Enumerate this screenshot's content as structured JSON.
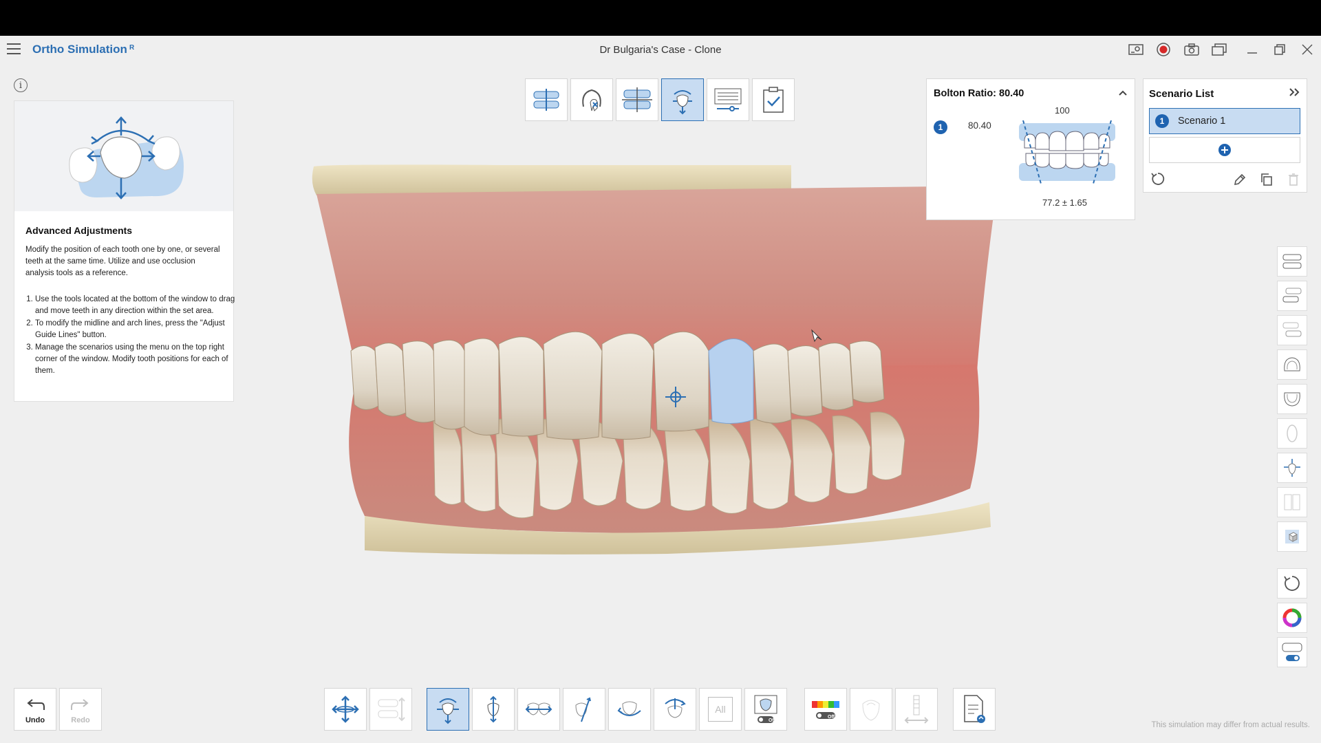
{
  "app": {
    "title": "Ortho Simulation",
    "title_suffix": "R",
    "case_title": "Dr Bulgaria's Case - Clone"
  },
  "help": {
    "title": "Advanced Adjustments",
    "description": "Modify the position of each tooth one by one, or several teeth at the same time. Utilize and use occlusion analysis tools as a reference.",
    "steps": [
      "Use the tools located at the bottom of the window to drag and move teeth in any direction within the set area.",
      "To modify the midline and arch lines, press the \"Adjust Guide Lines\" button.",
      "Manage the scenarios using the menu on the top right corner of the window. Modify tooth positions for each of them."
    ]
  },
  "bolton": {
    "title": "Bolton Ratio: 80.40",
    "badge": "1",
    "value": "80.40",
    "top_value": "100",
    "range": "77.2 ± 1.65"
  },
  "scenarios": {
    "title": "Scenario List",
    "items": [
      {
        "badge": "1",
        "label": "Scenario 1"
      }
    ]
  },
  "undo": {
    "undo_label": "Undo",
    "redo_label": "Redo"
  },
  "bottom_tools": {
    "all_label": "All",
    "toggle_off": "Off"
  },
  "disclaimer": "This simulation may differ from actual results.",
  "colors": {
    "accent": "#2c6fb3",
    "active_bg": "#c8dcf2",
    "badge": "#1f63b0",
    "record": "#d62828"
  }
}
